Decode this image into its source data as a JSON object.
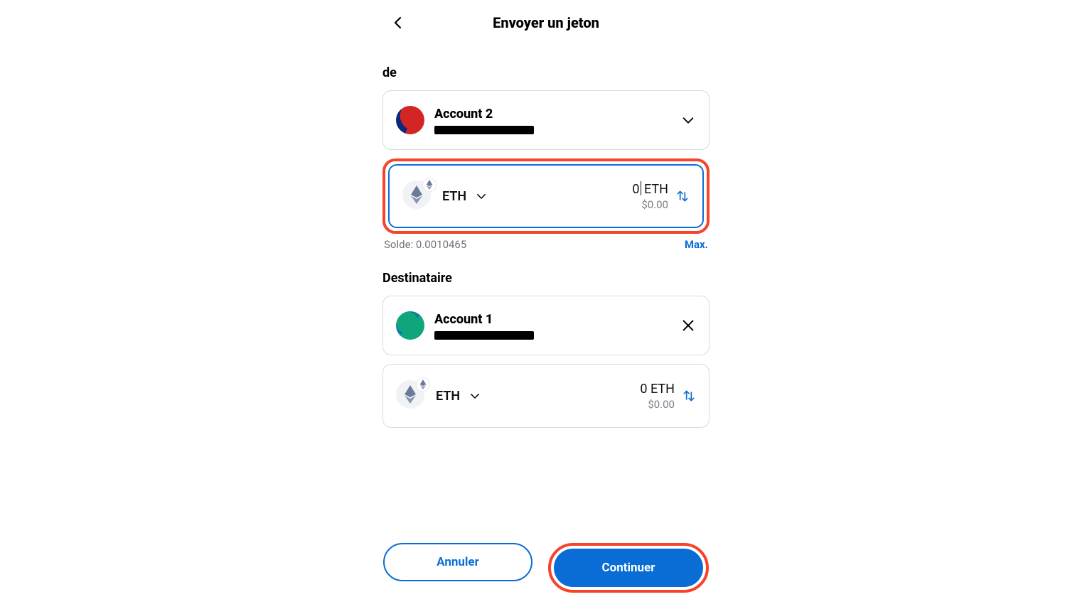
{
  "header": {
    "title": "Envoyer un jeton"
  },
  "from": {
    "label": "de",
    "account_name": "Account 2"
  },
  "from_token": {
    "symbol": "ETH",
    "amount": "0",
    "unit": "ETH",
    "fiat": "$0.00"
  },
  "balance": {
    "prefix": "Solde: ",
    "value": "0.0010465",
    "max_label": "Max."
  },
  "recipient": {
    "label": "Destinataire",
    "account_name": "Account 1"
  },
  "recipient_token": {
    "symbol": "ETH",
    "amount": "0",
    "unit": "ETH",
    "fiat": "$0.00"
  },
  "actions": {
    "cancel": "Annuler",
    "continue": "Continuer"
  }
}
